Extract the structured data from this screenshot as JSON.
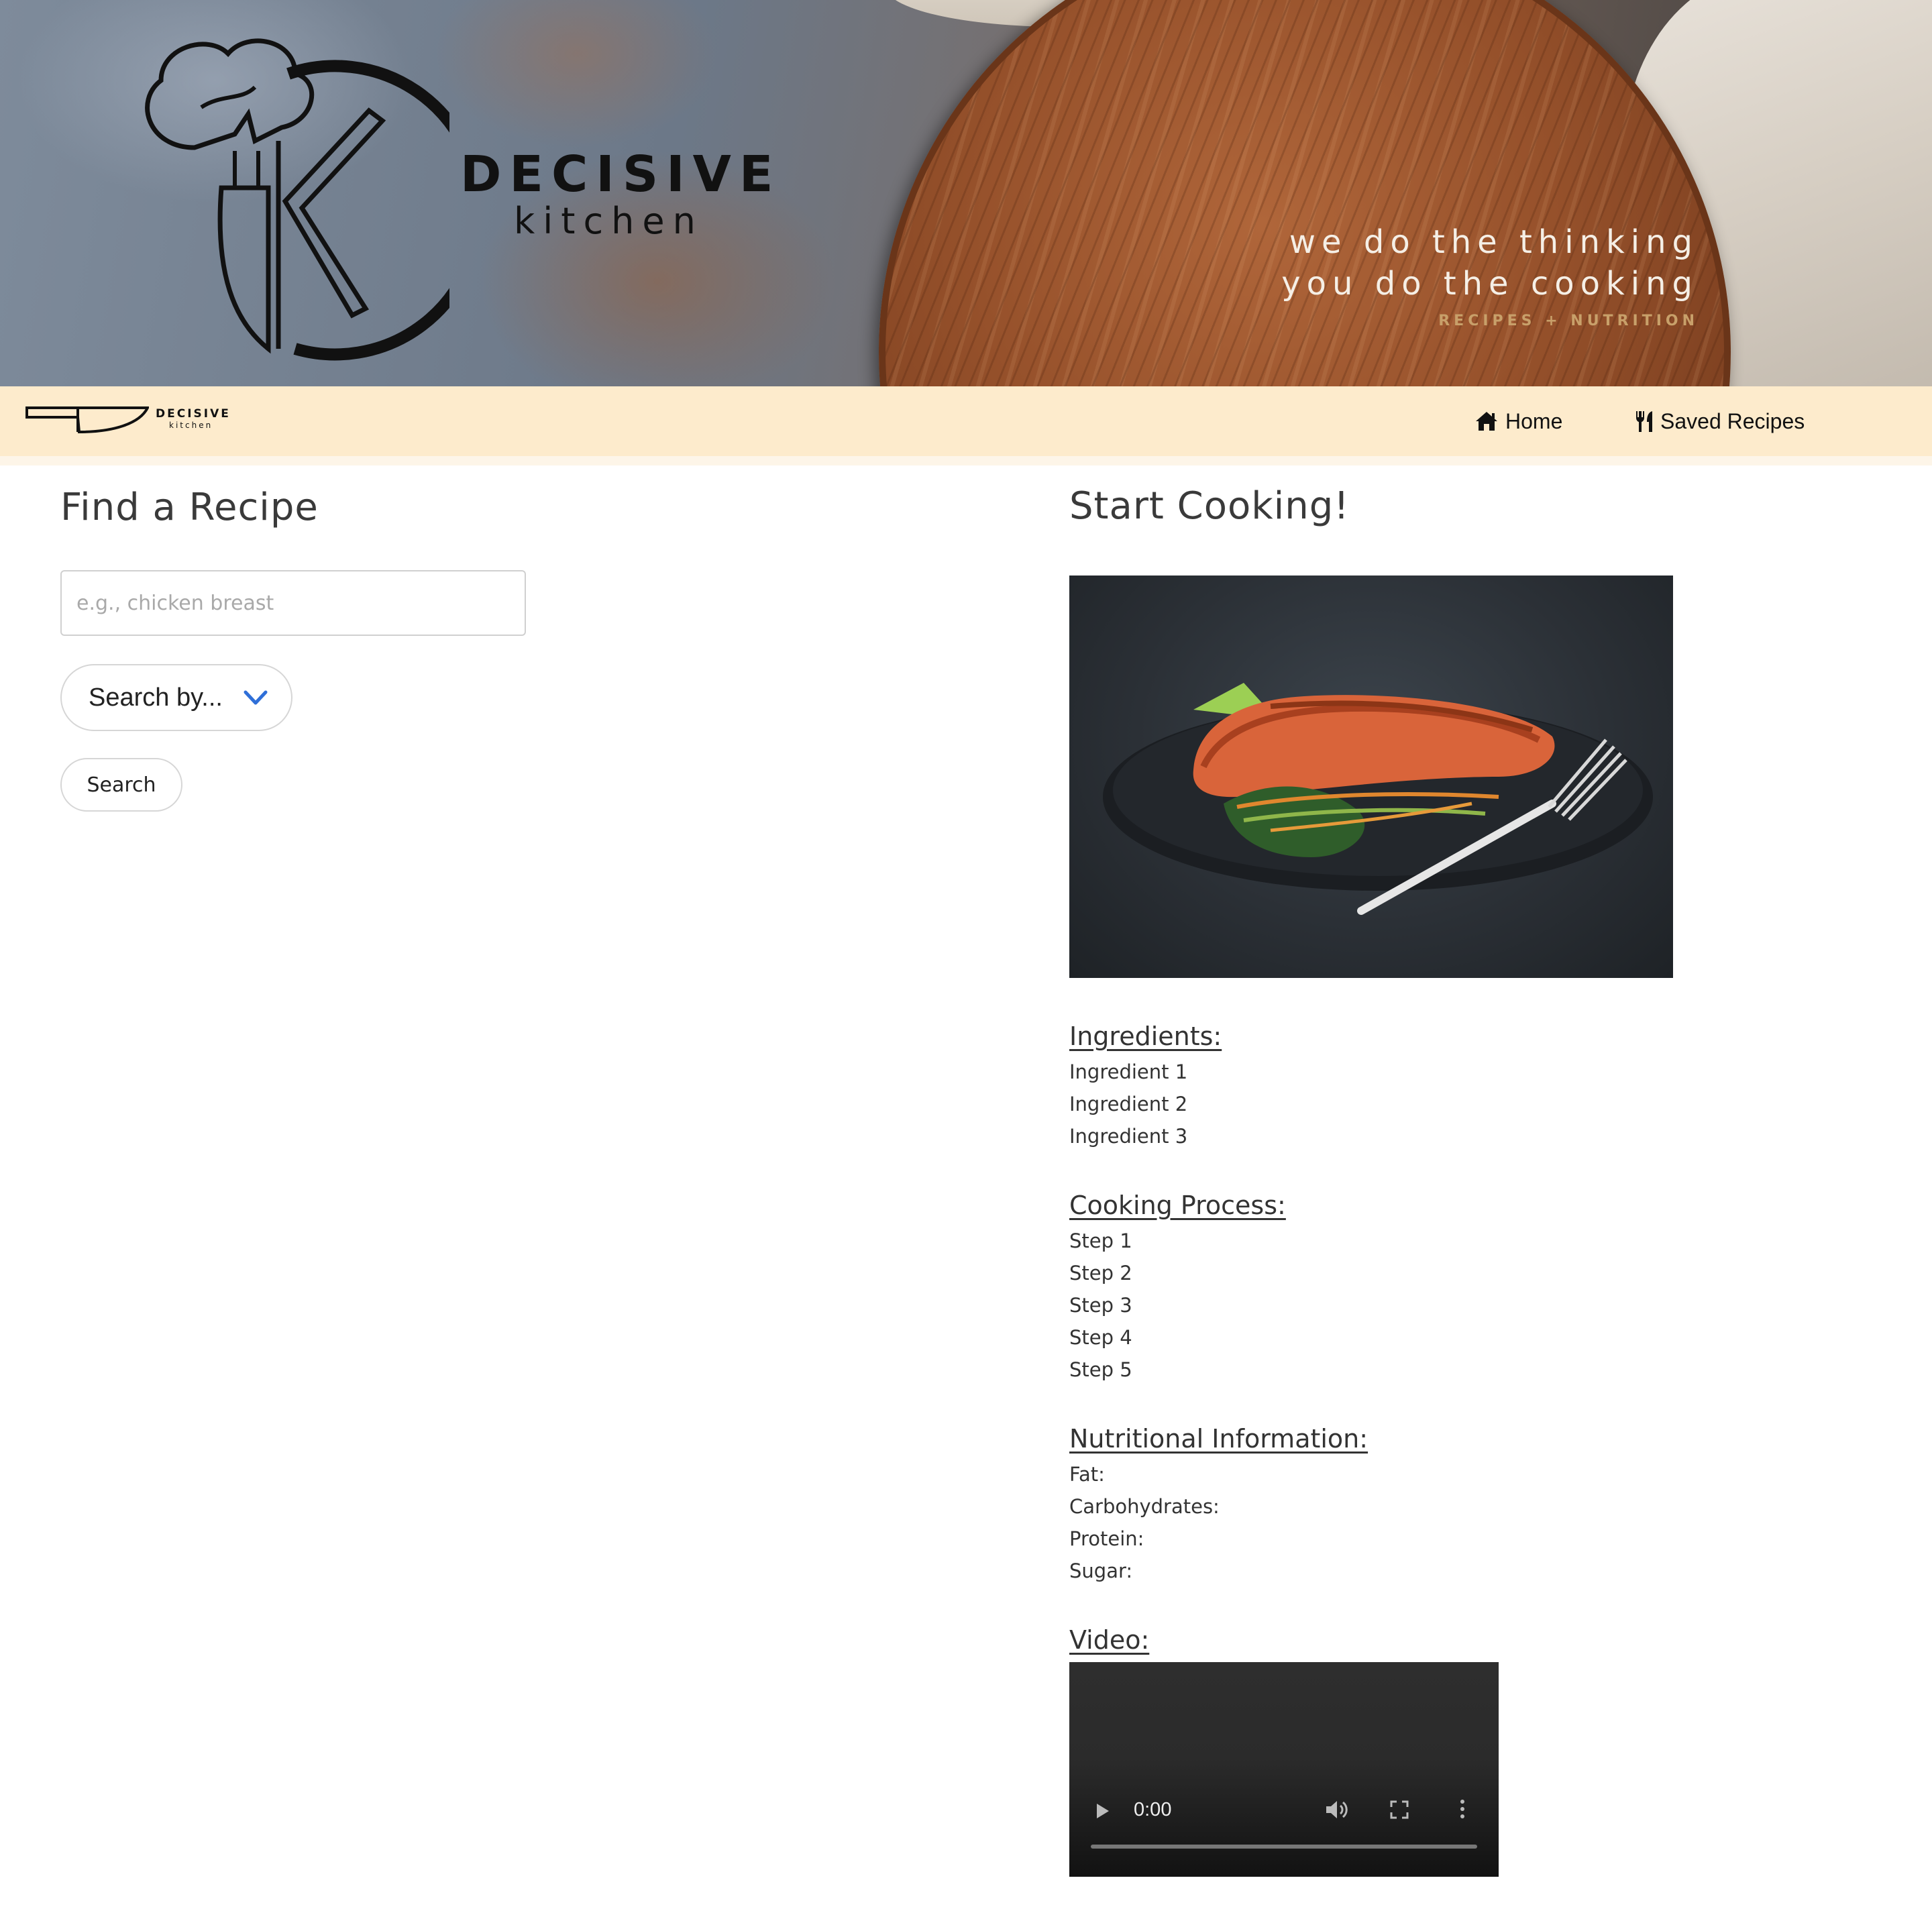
{
  "hero": {
    "brand_line1": "DECISIVE",
    "brand_line2": "kitchen",
    "tagline_line1": "we do the thinking",
    "tagline_line2": "you do the cooking",
    "tagline_sub": "RECIPES + NUTRITION"
  },
  "navbar": {
    "brand_line1": "DECISIVE",
    "brand_line2": "kitchen",
    "home_icon": "home-icon",
    "home_label": "Home",
    "saved_icon": "utensils-icon",
    "saved_label": "Saved Recipes",
    "background": "#fdebcc"
  },
  "find": {
    "heading": "Find a Recipe",
    "search_placeholder": "e.g., chicken breast",
    "search_value": "",
    "select_label": "Search by...",
    "search_button": "Search"
  },
  "recipe": {
    "heading": "Start Cooking!",
    "photo": "salmon-plate-image",
    "ingredients_title": "Ingredients:",
    "ingredients": [
      "Ingredient 1",
      "Ingredient 2",
      "Ingredient 3"
    ],
    "cooking_title": "Cooking Process:",
    "steps": [
      "Step 1",
      "Step 2",
      "Step 3",
      "Step 4",
      "Step 5"
    ],
    "nutrition_title": "Nutritional Information:",
    "nutrition": [
      "Fat:",
      "Carbohydrates:",
      "Protein:",
      "Sugar:"
    ],
    "video_title": "Video:",
    "video_time": "0:00"
  },
  "colors": {
    "accent_chevron": "#2f6fd8",
    "navbar_bg": "#fdebcc"
  }
}
